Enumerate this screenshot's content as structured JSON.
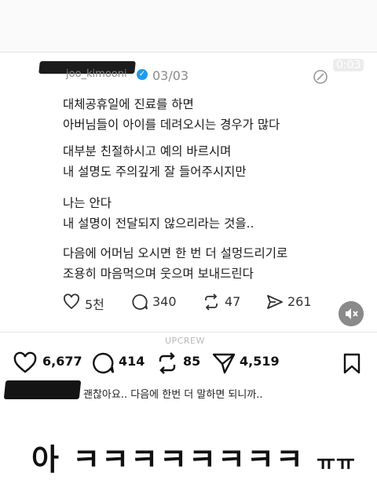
{
  "post": {
    "username": "joo_kimooni",
    "index": "03/03",
    "time_badge": "0:03",
    "lines": [
      "대체공휴일에 진료를 하면",
      "아버님들이 아이를 데려오시는 경우가 많다",
      "대부분 친절하시고 예의 바르시며",
      "내 설명도 주의깊게 잘 들어주시지만",
      "나는 안다",
      "내 설명이 전달되지 않으리라는 것을..",
      "다음에 어머님 오시면 한 번 더 설멍드리기로",
      "조용히 마음먹으며 웃으며 보내드린다"
    ],
    "stats": {
      "likes": "5천",
      "comments": "340",
      "reposts": "47",
      "shares": "261"
    }
  },
  "watermark": "UPCREW",
  "instagram": {
    "likes": "6,677",
    "comments": "414",
    "reposts": "85",
    "shares": "4,519"
  },
  "comment": {
    "text": "괜찮아요.. 다음에 한번 더 말하면 되니까.."
  },
  "reaction": {
    "main": "아 ㅋㅋㅋㅋㅋㅋㅋㅋ",
    "tail": "ㅠㅠ"
  }
}
